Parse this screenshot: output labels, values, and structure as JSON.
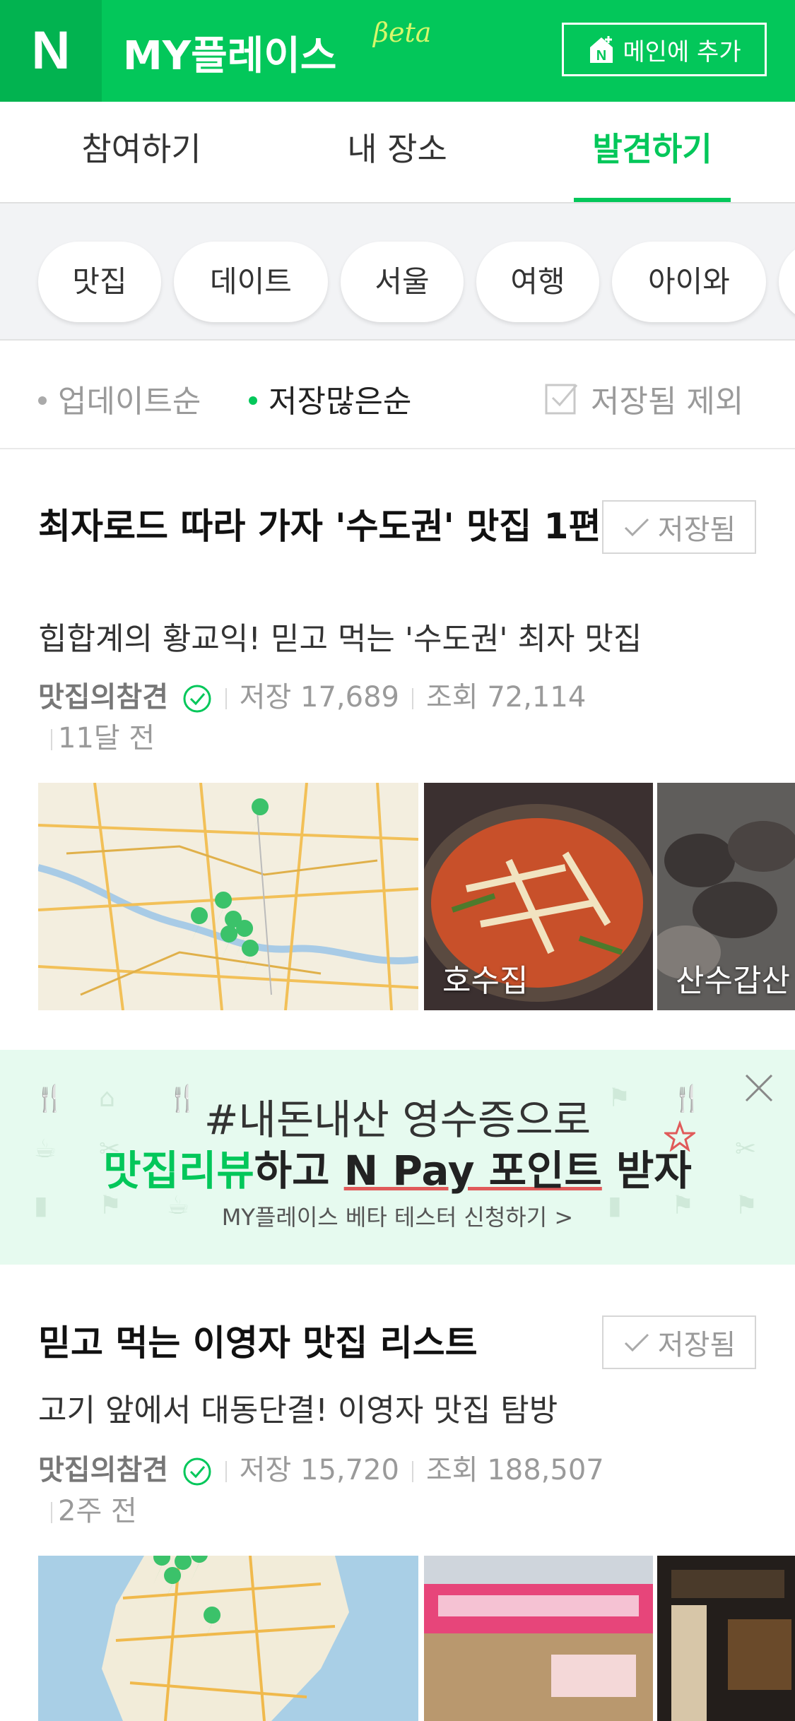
{
  "header": {
    "logo": "N",
    "title": "MY플레이스",
    "beta": "βeta",
    "add_main_label": "메인에 추가"
  },
  "tabs": [
    {
      "label": "참여하기",
      "active": false
    },
    {
      "label": "내 장소",
      "active": false
    },
    {
      "label": "발견하기",
      "active": true
    }
  ],
  "chips": [
    "맛집",
    "데이트",
    "서울",
    "여행",
    "아이와"
  ],
  "sort": {
    "options": [
      {
        "label": "업데이트순",
        "active": false
      },
      {
        "label": "저장많은순",
        "active": true
      }
    ],
    "exclude_saved": "저장됨 제외"
  },
  "cards": [
    {
      "title": "최자로드 따라 가자 '수도권' 맛집 1편",
      "saved_label": "저장됨",
      "subtitle": "힙합계의 황교익! 믿고 먹는 '수도권' 최자 맛집",
      "author": "맛집의참견",
      "saves": "저장 17,689",
      "views": "조회 72,114",
      "time": "11달 전",
      "thumb_labels": [
        "호수집",
        "산수갑산"
      ]
    },
    {
      "title": "믿고 먹는 이영자 맛집 리스트",
      "saved_label": "저장됨",
      "subtitle": "고기 앞에서 대동단결! 이영자 맛집 탐방",
      "author": "맛집의참견",
      "saves": "저장 15,720",
      "views": "조회 188,507",
      "time": "2주 전"
    }
  ],
  "banner": {
    "line1": "#내돈내산 영수증으로",
    "line2_green": "맛집리뷰",
    "line2_a": "하고 ",
    "line2_b": "N Pay 포인트",
    "line2_c": " 받자",
    "line3": "MY플레이스 베타 테스터 신청하기 >"
  },
  "colors": {
    "brand": "#03c75a",
    "brand_dark": "#02b350",
    "banner_bg": "#e6faef",
    "beta": "#d7f76b"
  }
}
